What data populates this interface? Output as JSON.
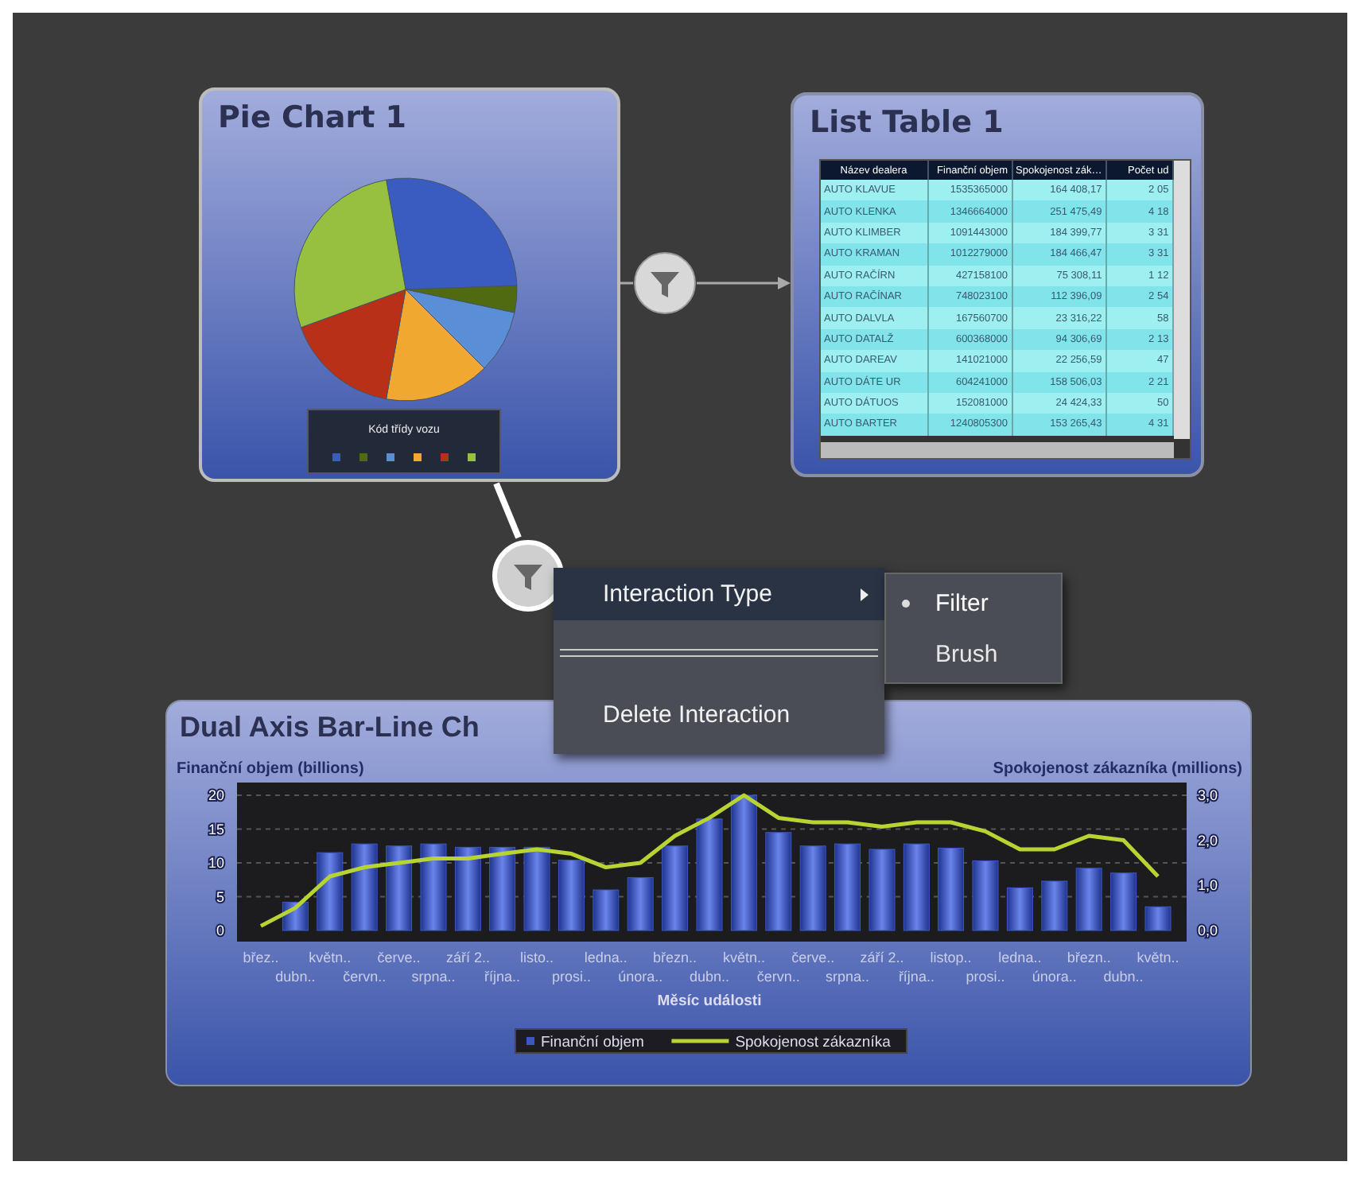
{
  "pie_card": {
    "title": "Pie Chart 1",
    "legend_title": "Kód třídy vozu"
  },
  "table_card": {
    "title": "List Table 1",
    "columns": [
      "Název dealera",
      "Finanční objem",
      "Spokojenost zák…",
      "Počet ud"
    ],
    "rows": [
      [
        "AUTO KLAVUE",
        "1535365000",
        "164 408,17",
        "2 05"
      ],
      [
        "AUTO KLENKA",
        "1346664000",
        "251 475,49",
        "4 18"
      ],
      [
        "AUTO KLIMBER",
        "1091443000",
        "184 399,77",
        "3 31"
      ],
      [
        "AUTO KRAMAN",
        "1012279000",
        "184 466,47",
        "3 31"
      ],
      [
        "AUTO RAČÍRN",
        "427158100",
        "75 308,11",
        "1 12"
      ],
      [
        "AUTO RAČÍNAR",
        "748023100",
        "112 396,09",
        "2 54"
      ],
      [
        "AUTO DALVLA",
        "167560700",
        "23 316,22",
        "58"
      ],
      [
        "AUTO DATALŽ",
        "600368000",
        "94 306,69",
        "2 13"
      ],
      [
        "AUTO DAREAV",
        "141021000",
        "22 256,59",
        "47"
      ],
      [
        "AUTO DÁTE UR",
        "604241000",
        "158 506,03",
        "2 21"
      ],
      [
        "AUTO DÁTUOS",
        "152081000",
        "24 424,33",
        "50"
      ],
      [
        "AUTO BARTER",
        "1240805300",
        "153 265,43",
        "4 31"
      ]
    ]
  },
  "chart_card": {
    "title": "Dual Axis Bar-Line Ch",
    "chart_data": {
      "type": "bar",
      "xlabel": "Měsíc události",
      "ylabel": "Finanční objem (billions)",
      "y2label": "Spokojenost zákazníka (millions)",
      "categories": [
        "břez..",
        "dubn..",
        "květn..",
        "červn..",
        "červe..",
        "srpna..",
        "září 2..",
        "října..",
        "listo..",
        "prosi..",
        "ledna..",
        "února..",
        "březn..",
        "dubn..",
        "květn..",
        "červn..",
        "červe..",
        "srpna..",
        "září 2..",
        "října..",
        "listop..",
        "prosi..",
        "ledna..",
        "února..",
        "březn..",
        "dubn..",
        "květn.."
      ],
      "series": [
        {
          "name": "Finanční objem",
          "color": "#3c56c4",
          "values": [
            0,
            4.2,
            11.5,
            12.8,
            12.5,
            12.8,
            12.3,
            12.3,
            12.3,
            10.4,
            6,
            7.8,
            12.5,
            16.5,
            20,
            14.5,
            12.5,
            12.8,
            12,
            12.8,
            12.2,
            10.3,
            6.3,
            7.3,
            9.2,
            8.5,
            3.5
          ]
        },
        {
          "name": "Spokojenost zákazníka",
          "color": "#b8d432",
          "type": "line",
          "axis": "y2",
          "values": [
            0.1,
            0.5,
            1.2,
            1.4,
            1.5,
            1.6,
            1.6,
            1.7,
            1.8,
            1.7,
            1.4,
            1.5,
            2.1,
            2.5,
            3.0,
            2.5,
            2.4,
            2.4,
            2.3,
            2.4,
            2.4,
            2.2,
            1.8,
            1.8,
            2.1,
            2.0,
            1.2
          ]
        }
      ],
      "grid": true,
      "legend": true,
      "ylim": [
        0,
        20
      ],
      "yticks": [
        0,
        5,
        10,
        15,
        20
      ],
      "y2lim": [
        0,
        3
      ],
      "y2ticks": [
        {
          "value": 0,
          "label": "0,0"
        },
        {
          "value": 1,
          "label": "1,0"
        },
        {
          "value": 2,
          "label": "2,0"
        },
        {
          "value": 3,
          "label": "3,0"
        }
      ]
    }
  },
  "menu": {
    "items": [
      {
        "kind": "submenu",
        "label": "Interaction Type",
        "selected": true
      },
      {
        "kind": "separator"
      },
      {
        "kind": "action",
        "label": "Delete Interaction",
        "selected": false
      }
    ]
  },
  "submenu": {
    "items": [
      {
        "label": "Filter",
        "selected": true
      },
      {
        "label": "Brush",
        "selected": false
      }
    ]
  }
}
